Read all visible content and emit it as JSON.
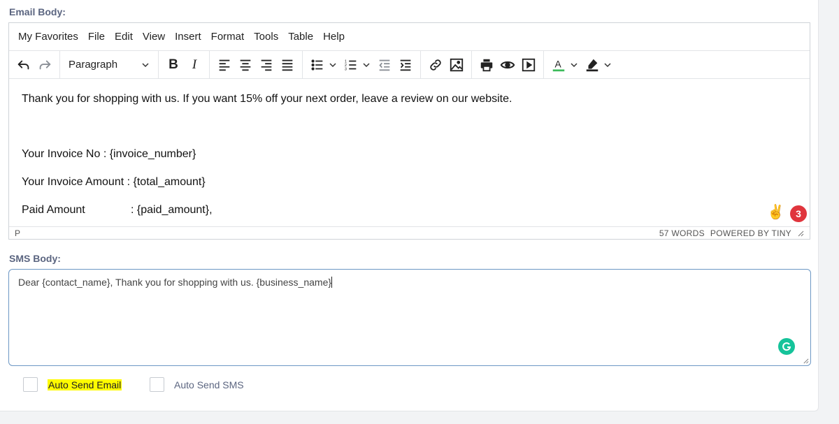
{
  "email_label": "Email Body:",
  "sms_label": "SMS Body:",
  "menubar": [
    "My Favorites",
    "File",
    "Edit",
    "View",
    "Insert",
    "Format",
    "Tools",
    "Table",
    "Help"
  ],
  "toolbar": {
    "block_format": "Paragraph",
    "text_color": "#3dbb5b",
    "highlight_color": "#222222"
  },
  "editor_content": {
    "line1": "Thank you for shopping with us. If you want 15% off your next order, leave a review on our website.",
    "line2": "Your Invoice No : {invoice_number}",
    "line3": "Your Invoice Amount : {total_amount}",
    "line4_label": "Paid Amount",
    "line4_value": ":  {paid_amount},"
  },
  "statusbar": {
    "path": "P",
    "word_count": "57 WORDS",
    "powered_by": "POWERED BY TINY"
  },
  "notification_badge": "3",
  "sms_body": "Dear {contact_name}, Thank you for shopping with us. {business_name}",
  "checkboxes": {
    "auto_send_email": "Auto Send Email",
    "auto_send_sms": "Auto Send SMS"
  }
}
